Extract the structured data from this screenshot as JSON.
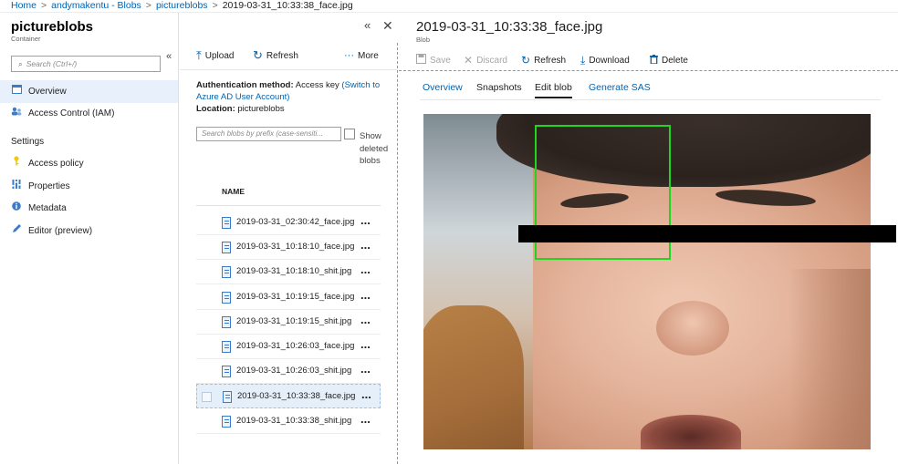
{
  "breadcrumb": {
    "items": [
      "Home",
      "andymakentu - Blobs",
      "pictureblobs"
    ],
    "current": "2019-03-31_10:33:38_face.jpg",
    "separator": ">"
  },
  "container_blade": {
    "title": "pictureblobs",
    "subtitle": "Container",
    "search_placeholder": "Search (Ctrl+/)",
    "collapse_glyph": "«",
    "nav": [
      {
        "label": "Overview",
        "icon": "overview-icon",
        "active": true
      },
      {
        "label": "Access Control (IAM)",
        "icon": "iam-icon",
        "active": false
      }
    ],
    "settings_label": "Settings",
    "settings_items": [
      {
        "label": "Access policy",
        "icon": "key-icon"
      },
      {
        "label": "Properties",
        "icon": "properties-icon"
      },
      {
        "label": "Metadata",
        "icon": "info-icon"
      },
      {
        "label": "Editor (preview)",
        "icon": "pencil-icon"
      }
    ]
  },
  "blob_list": {
    "commands": {
      "upload": "Upload",
      "refresh": "Refresh",
      "more": "More"
    },
    "auth_label": "Authentication method:",
    "auth_value": "Access key",
    "auth_link": "(Switch to Azure AD User Account)",
    "location_label": "Location:",
    "location_value": "pictureblobs",
    "prefix_placeholder": "Search blobs by prefix (case-sensiti...",
    "show_deleted": "Show deleted blobs",
    "column_name": "NAME",
    "row_menu": "...",
    "files": [
      "2019-03-31_02:30:42_face.jpg",
      "2019-03-31_10:18:10_face.jpg",
      "2019-03-31_10:18:10_shit.jpg",
      "2019-03-31_10:19:15_face.jpg",
      "2019-03-31_10:19:15_shit.jpg",
      "2019-03-31_10:26:03_face.jpg",
      "2019-03-31_10:26:03_shit.jpg",
      "2019-03-31_10:33:38_face.jpg",
      "2019-03-31_10:33:38_shit.jpg"
    ],
    "selected_index": 7
  },
  "blob_blade": {
    "title": "2019-03-31_10:33:38_face.jpg",
    "subtitle": "Blob",
    "commands": {
      "save": "Save",
      "discard": "Discard",
      "refresh": "Refresh",
      "download": "Download",
      "delete": "Delete"
    },
    "tabs": [
      "Overview",
      "Snapshots",
      "Edit blob",
      "Generate SAS"
    ],
    "active_tab": "Edit blob",
    "collapse_glyph": "«",
    "close_glyph": "✕"
  },
  "colors": {
    "link": "#0063b1",
    "active_nav_bg": "#e8f1fb",
    "face_box": "#22d422"
  }
}
